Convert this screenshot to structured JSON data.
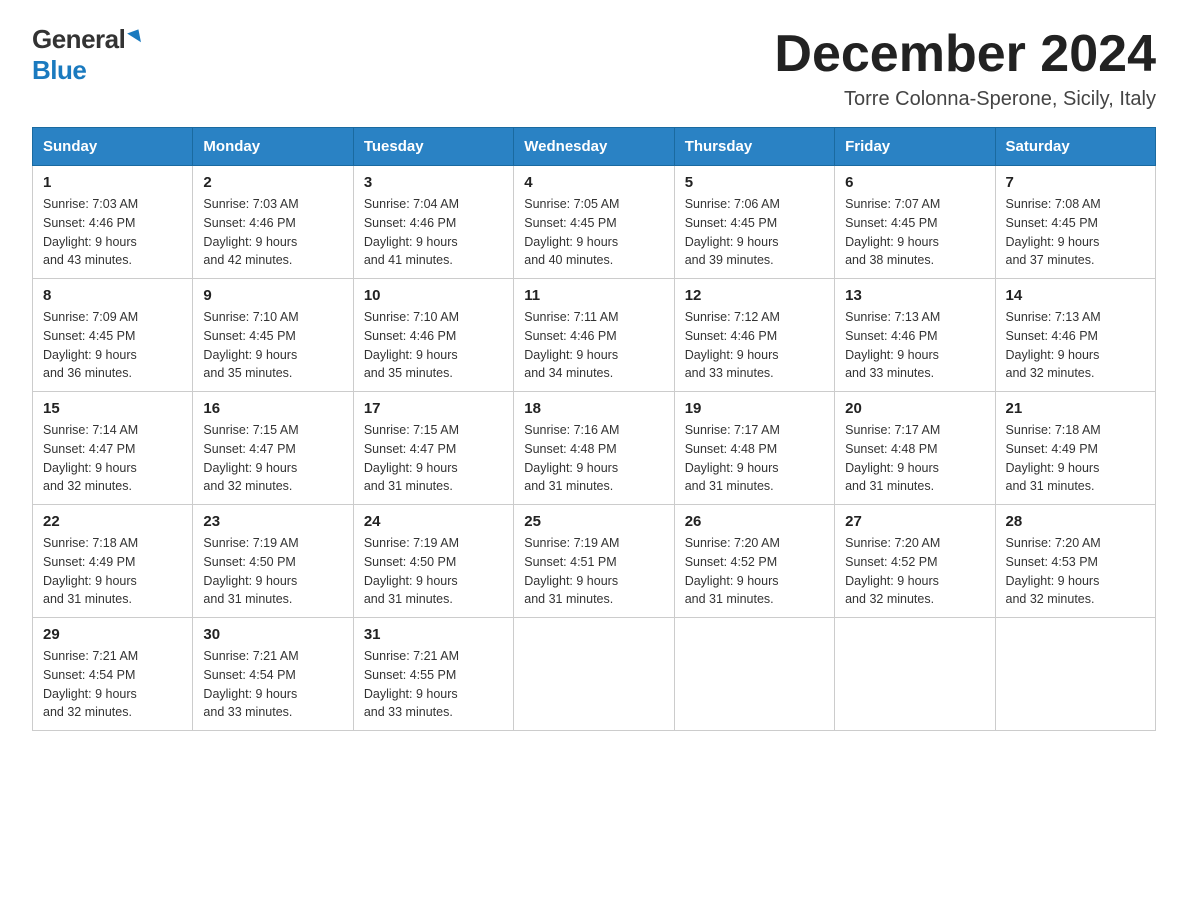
{
  "logo": {
    "general": "General",
    "blue": "Blue"
  },
  "title": {
    "month": "December 2024",
    "location": "Torre Colonna-Sperone, Sicily, Italy"
  },
  "headers": [
    "Sunday",
    "Monday",
    "Tuesday",
    "Wednesday",
    "Thursday",
    "Friday",
    "Saturday"
  ],
  "weeks": [
    [
      {
        "day": "1",
        "sunrise": "7:03 AM",
        "sunset": "4:46 PM",
        "daylight": "9 hours and 43 minutes."
      },
      {
        "day": "2",
        "sunrise": "7:03 AM",
        "sunset": "4:46 PM",
        "daylight": "9 hours and 42 minutes."
      },
      {
        "day": "3",
        "sunrise": "7:04 AM",
        "sunset": "4:46 PM",
        "daylight": "9 hours and 41 minutes."
      },
      {
        "day": "4",
        "sunrise": "7:05 AM",
        "sunset": "4:45 PM",
        "daylight": "9 hours and 40 minutes."
      },
      {
        "day": "5",
        "sunrise": "7:06 AM",
        "sunset": "4:45 PM",
        "daylight": "9 hours and 39 minutes."
      },
      {
        "day": "6",
        "sunrise": "7:07 AM",
        "sunset": "4:45 PM",
        "daylight": "9 hours and 38 minutes."
      },
      {
        "day": "7",
        "sunrise": "7:08 AM",
        "sunset": "4:45 PM",
        "daylight": "9 hours and 37 minutes."
      }
    ],
    [
      {
        "day": "8",
        "sunrise": "7:09 AM",
        "sunset": "4:45 PM",
        "daylight": "9 hours and 36 minutes."
      },
      {
        "day": "9",
        "sunrise": "7:10 AM",
        "sunset": "4:45 PM",
        "daylight": "9 hours and 35 minutes."
      },
      {
        "day": "10",
        "sunrise": "7:10 AM",
        "sunset": "4:46 PM",
        "daylight": "9 hours and 35 minutes."
      },
      {
        "day": "11",
        "sunrise": "7:11 AM",
        "sunset": "4:46 PM",
        "daylight": "9 hours and 34 minutes."
      },
      {
        "day": "12",
        "sunrise": "7:12 AM",
        "sunset": "4:46 PM",
        "daylight": "9 hours and 33 minutes."
      },
      {
        "day": "13",
        "sunrise": "7:13 AM",
        "sunset": "4:46 PM",
        "daylight": "9 hours and 33 minutes."
      },
      {
        "day": "14",
        "sunrise": "7:13 AM",
        "sunset": "4:46 PM",
        "daylight": "9 hours and 32 minutes."
      }
    ],
    [
      {
        "day": "15",
        "sunrise": "7:14 AM",
        "sunset": "4:47 PM",
        "daylight": "9 hours and 32 minutes."
      },
      {
        "day": "16",
        "sunrise": "7:15 AM",
        "sunset": "4:47 PM",
        "daylight": "9 hours and 32 minutes."
      },
      {
        "day": "17",
        "sunrise": "7:15 AM",
        "sunset": "4:47 PM",
        "daylight": "9 hours and 31 minutes."
      },
      {
        "day": "18",
        "sunrise": "7:16 AM",
        "sunset": "4:48 PM",
        "daylight": "9 hours and 31 minutes."
      },
      {
        "day": "19",
        "sunrise": "7:17 AM",
        "sunset": "4:48 PM",
        "daylight": "9 hours and 31 minutes."
      },
      {
        "day": "20",
        "sunrise": "7:17 AM",
        "sunset": "4:48 PM",
        "daylight": "9 hours and 31 minutes."
      },
      {
        "day": "21",
        "sunrise": "7:18 AM",
        "sunset": "4:49 PM",
        "daylight": "9 hours and 31 minutes."
      }
    ],
    [
      {
        "day": "22",
        "sunrise": "7:18 AM",
        "sunset": "4:49 PM",
        "daylight": "9 hours and 31 minutes."
      },
      {
        "day": "23",
        "sunrise": "7:19 AM",
        "sunset": "4:50 PM",
        "daylight": "9 hours and 31 minutes."
      },
      {
        "day": "24",
        "sunrise": "7:19 AM",
        "sunset": "4:50 PM",
        "daylight": "9 hours and 31 minutes."
      },
      {
        "day": "25",
        "sunrise": "7:19 AM",
        "sunset": "4:51 PM",
        "daylight": "9 hours and 31 minutes."
      },
      {
        "day": "26",
        "sunrise": "7:20 AM",
        "sunset": "4:52 PM",
        "daylight": "9 hours and 31 minutes."
      },
      {
        "day": "27",
        "sunrise": "7:20 AM",
        "sunset": "4:52 PM",
        "daylight": "9 hours and 32 minutes."
      },
      {
        "day": "28",
        "sunrise": "7:20 AM",
        "sunset": "4:53 PM",
        "daylight": "9 hours and 32 minutes."
      }
    ],
    [
      {
        "day": "29",
        "sunrise": "7:21 AM",
        "sunset": "4:54 PM",
        "daylight": "9 hours and 32 minutes."
      },
      {
        "day": "30",
        "sunrise": "7:21 AM",
        "sunset": "4:54 PM",
        "daylight": "9 hours and 33 minutes."
      },
      {
        "day": "31",
        "sunrise": "7:21 AM",
        "sunset": "4:55 PM",
        "daylight": "9 hours and 33 minutes."
      },
      null,
      null,
      null,
      null
    ]
  ],
  "labels": {
    "sunrise": "Sunrise:",
    "sunset": "Sunset:",
    "daylight": "Daylight:"
  }
}
